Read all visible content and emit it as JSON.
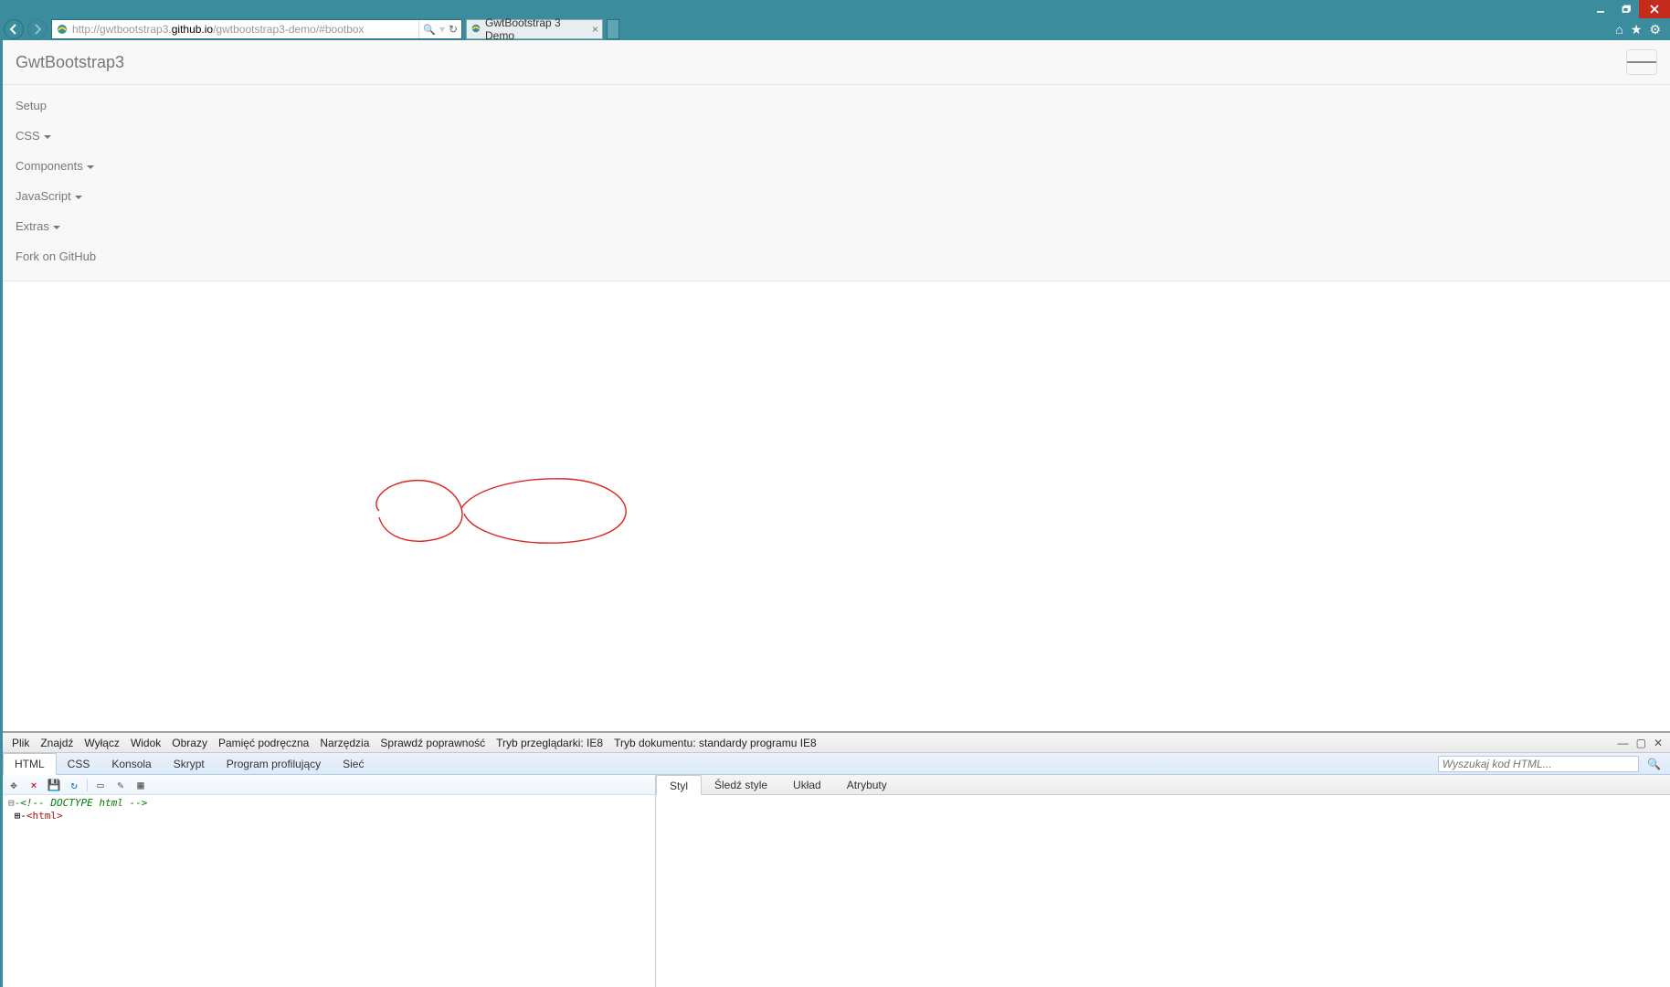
{
  "browser": {
    "url_pre": "http://gwtbootstrap3.",
    "url_bold": "github.io",
    "url_post": "/gwtbootstrap3-demo/#bootbox",
    "tab_title": "GwtBootstrap 3 Demo",
    "search_glyph": "🔍",
    "refresh_glyph": "↻"
  },
  "page": {
    "brand": "GwtBootstrap3",
    "nav": {
      "setup": "Setup",
      "css": "CSS",
      "components": "Components",
      "javascript": "JavaScript",
      "extras": "Extras",
      "fork": "Fork on GitHub"
    }
  },
  "devtools": {
    "menu": {
      "plik": "Plik",
      "znajdz": "Znajdź",
      "wylacz": "Wyłącz",
      "widok": "Widok",
      "obrazy": "Obrazy",
      "pamiec": "Pamięć podręczna",
      "narzedzia": "Narzędzia",
      "sprawdz": "Sprawdź poprawność",
      "tryb_przegl": "Tryb przeglądarki: IE8",
      "tryb_dok": "Tryb dokumentu: standardy programu IE8"
    },
    "tabs": {
      "html": "HTML",
      "css": "CSS",
      "konsola": "Konsola",
      "skrypt": "Skrypt",
      "profil": "Program profilujący",
      "siec": "Sieć"
    },
    "search_placeholder": "Wyszukaj kod HTML...",
    "right_tabs": {
      "styl": "Styl",
      "sledz": "Śledź style",
      "uklad": "Układ",
      "atrybuty": "Atrybuty"
    },
    "source": {
      "line1": "⊟-<!-- DOCTYPE html -->",
      "line2_prefix": " ⊞-",
      "line2_tag": "<html>"
    }
  }
}
